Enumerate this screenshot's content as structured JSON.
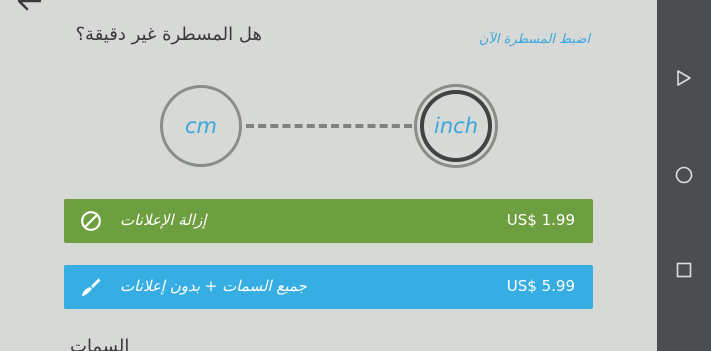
{
  "header": {
    "back_icon": "arrow-left-icon",
    "question": "هل المسطرة غير دقيقة؟",
    "calibrate_link": "اضبط المسطرة الآن"
  },
  "units": {
    "left_label": "cm",
    "right_label": "inch",
    "selected": "inch"
  },
  "purchases": [
    {
      "label": "إزالة الإعلانات",
      "price": "US$ 1.99",
      "icon": "block-icon",
      "color": "#6d9e3f"
    },
    {
      "label": "جميع السمات + بدون إعلانات",
      "price": "US$ 5.99",
      "icon": "paint-brush-icon",
      "color": "#36ade3"
    }
  ],
  "section": {
    "title": "السمات"
  },
  "nav_bar": {
    "back": "triangle-back-icon",
    "home": "circle-home-icon",
    "recents": "square-recents-icon"
  },
  "colors": {
    "background": "#d6d9d5",
    "accent": "#3aa7dd",
    "nav_bar": "#4b4e50"
  }
}
